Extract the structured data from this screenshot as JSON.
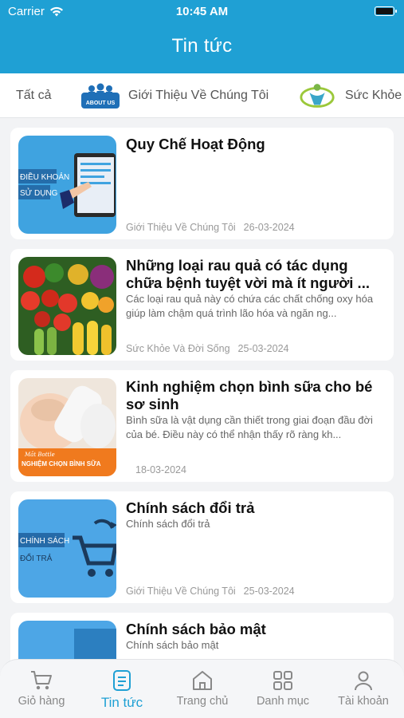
{
  "status_bar": {
    "carrier": "Carrier",
    "time": "10:45 AM"
  },
  "header": {
    "title": "Tin tức"
  },
  "tabs": [
    {
      "label": "Tất cả",
      "icon": "none"
    },
    {
      "label": "Giới Thiệu Về Chúng Tôi",
      "icon": "about-us-icon"
    },
    {
      "label": "Sức Khỏe Và Đời Sống",
      "icon": "health-icon"
    }
  ],
  "about_icon_text": "ABOUT US",
  "articles": [
    {
      "title": "Quy Chế Hoạt Động",
      "description": "",
      "category": "Giới Thiệu Về Chúng Tôi",
      "date": "26-03-2024",
      "thumb_text": [
        "ĐIỀU KHOẢN",
        "SỬ DỤNG"
      ]
    },
    {
      "title": "Những loại rau quả có tác dụng chữa bệnh tuyệt vời mà ít người ...",
      "description": "Các loại rau quả này có chứa các chất chống oxy hóa giúp làm chậm quá trình lão hóa và ngăn ng...",
      "category": "Sức Khỏe Và Đời Sống",
      "date": "25-03-2024",
      "thumb_text": []
    },
    {
      "title": "Kinh nghiệm chọn bình sữa cho bé sơ sinh",
      "description": "Bình sữa là vật dụng cần thiết trong giai đoạn đầu đời của bé. Điều này có thể nhận thấy rõ ràng kh...",
      "category": "",
      "date": "18-03-2024",
      "thumb_text": [
        "Mắt Bottle",
        "NGHIỆM CHỌN BÌNH SỮA"
      ]
    },
    {
      "title": "Chính sách đổi trả",
      "description": "Chính sách đổi trả",
      "category": "Giới Thiệu Về Chúng Tôi",
      "date": "25-03-2024",
      "thumb_text": [
        "CHÍNH SÁCH",
        "ĐỔI TRẢ"
      ]
    },
    {
      "title": "Chính sách bảo mật",
      "description": "Chính sách bảo mật",
      "category": "",
      "date": "",
      "thumb_text": []
    }
  ],
  "bottom_nav": [
    {
      "label": "Giỏ hàng",
      "icon": "cart-icon",
      "active": false
    },
    {
      "label": "Tin tức",
      "icon": "news-icon",
      "active": true
    },
    {
      "label": "Trang chủ",
      "icon": "home-icon",
      "active": false
    },
    {
      "label": "Danh mục",
      "icon": "grid-icon",
      "active": false
    },
    {
      "label": "Tài khoản",
      "icon": "user-icon",
      "active": false
    }
  ],
  "colors": {
    "primary": "#1fa0d4",
    "background": "#f2f3f5",
    "card": "#ffffff",
    "muted_text": "#999999"
  }
}
